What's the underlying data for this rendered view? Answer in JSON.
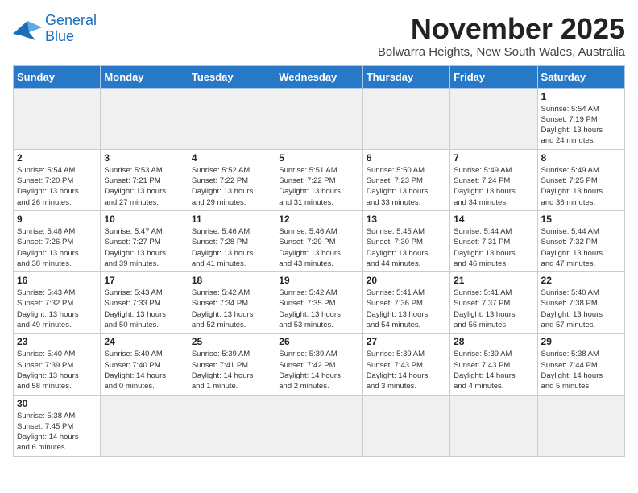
{
  "logo": {
    "line1": "General",
    "line2": "Blue"
  },
  "title": "November 2025",
  "location": "Bolwarra Heights, New South Wales, Australia",
  "weekdays": [
    "Sunday",
    "Monday",
    "Tuesday",
    "Wednesday",
    "Thursday",
    "Friday",
    "Saturday"
  ],
  "weeks": [
    [
      {
        "day": "",
        "info": ""
      },
      {
        "day": "",
        "info": ""
      },
      {
        "day": "",
        "info": ""
      },
      {
        "day": "",
        "info": ""
      },
      {
        "day": "",
        "info": ""
      },
      {
        "day": "",
        "info": ""
      },
      {
        "day": "1",
        "info": "Sunrise: 5:54 AM\nSunset: 7:19 PM\nDaylight: 13 hours\nand 24 minutes."
      }
    ],
    [
      {
        "day": "2",
        "info": "Sunrise: 5:54 AM\nSunset: 7:20 PM\nDaylight: 13 hours\nand 26 minutes."
      },
      {
        "day": "3",
        "info": "Sunrise: 5:53 AM\nSunset: 7:21 PM\nDaylight: 13 hours\nand 27 minutes."
      },
      {
        "day": "4",
        "info": "Sunrise: 5:52 AM\nSunset: 7:22 PM\nDaylight: 13 hours\nand 29 minutes."
      },
      {
        "day": "5",
        "info": "Sunrise: 5:51 AM\nSunset: 7:22 PM\nDaylight: 13 hours\nand 31 minutes."
      },
      {
        "day": "6",
        "info": "Sunrise: 5:50 AM\nSunset: 7:23 PM\nDaylight: 13 hours\nand 33 minutes."
      },
      {
        "day": "7",
        "info": "Sunrise: 5:49 AM\nSunset: 7:24 PM\nDaylight: 13 hours\nand 34 minutes."
      },
      {
        "day": "8",
        "info": "Sunrise: 5:49 AM\nSunset: 7:25 PM\nDaylight: 13 hours\nand 36 minutes."
      }
    ],
    [
      {
        "day": "9",
        "info": "Sunrise: 5:48 AM\nSunset: 7:26 PM\nDaylight: 13 hours\nand 38 minutes."
      },
      {
        "day": "10",
        "info": "Sunrise: 5:47 AM\nSunset: 7:27 PM\nDaylight: 13 hours\nand 39 minutes."
      },
      {
        "day": "11",
        "info": "Sunrise: 5:46 AM\nSunset: 7:28 PM\nDaylight: 13 hours\nand 41 minutes."
      },
      {
        "day": "12",
        "info": "Sunrise: 5:46 AM\nSunset: 7:29 PM\nDaylight: 13 hours\nand 43 minutes."
      },
      {
        "day": "13",
        "info": "Sunrise: 5:45 AM\nSunset: 7:30 PM\nDaylight: 13 hours\nand 44 minutes."
      },
      {
        "day": "14",
        "info": "Sunrise: 5:44 AM\nSunset: 7:31 PM\nDaylight: 13 hours\nand 46 minutes."
      },
      {
        "day": "15",
        "info": "Sunrise: 5:44 AM\nSunset: 7:32 PM\nDaylight: 13 hours\nand 47 minutes."
      }
    ],
    [
      {
        "day": "16",
        "info": "Sunrise: 5:43 AM\nSunset: 7:32 PM\nDaylight: 13 hours\nand 49 minutes."
      },
      {
        "day": "17",
        "info": "Sunrise: 5:43 AM\nSunset: 7:33 PM\nDaylight: 13 hours\nand 50 minutes."
      },
      {
        "day": "18",
        "info": "Sunrise: 5:42 AM\nSunset: 7:34 PM\nDaylight: 13 hours\nand 52 minutes."
      },
      {
        "day": "19",
        "info": "Sunrise: 5:42 AM\nSunset: 7:35 PM\nDaylight: 13 hours\nand 53 minutes."
      },
      {
        "day": "20",
        "info": "Sunrise: 5:41 AM\nSunset: 7:36 PM\nDaylight: 13 hours\nand 54 minutes."
      },
      {
        "day": "21",
        "info": "Sunrise: 5:41 AM\nSunset: 7:37 PM\nDaylight: 13 hours\nand 56 minutes."
      },
      {
        "day": "22",
        "info": "Sunrise: 5:40 AM\nSunset: 7:38 PM\nDaylight: 13 hours\nand 57 minutes."
      }
    ],
    [
      {
        "day": "23",
        "info": "Sunrise: 5:40 AM\nSunset: 7:39 PM\nDaylight: 13 hours\nand 58 minutes."
      },
      {
        "day": "24",
        "info": "Sunrise: 5:40 AM\nSunset: 7:40 PM\nDaylight: 14 hours\nand 0 minutes."
      },
      {
        "day": "25",
        "info": "Sunrise: 5:39 AM\nSunset: 7:41 PM\nDaylight: 14 hours\nand 1 minute."
      },
      {
        "day": "26",
        "info": "Sunrise: 5:39 AM\nSunset: 7:42 PM\nDaylight: 14 hours\nand 2 minutes."
      },
      {
        "day": "27",
        "info": "Sunrise: 5:39 AM\nSunset: 7:43 PM\nDaylight: 14 hours\nand 3 minutes."
      },
      {
        "day": "28",
        "info": "Sunrise: 5:39 AM\nSunset: 7:43 PM\nDaylight: 14 hours\nand 4 minutes."
      },
      {
        "day": "29",
        "info": "Sunrise: 5:38 AM\nSunset: 7:44 PM\nDaylight: 14 hours\nand 5 minutes."
      }
    ],
    [
      {
        "day": "30",
        "info": "Sunrise: 5:38 AM\nSunset: 7:45 PM\nDaylight: 14 hours\nand 6 minutes."
      },
      {
        "day": "",
        "info": ""
      },
      {
        "day": "",
        "info": ""
      },
      {
        "day": "",
        "info": ""
      },
      {
        "day": "",
        "info": ""
      },
      {
        "day": "",
        "info": ""
      },
      {
        "day": "",
        "info": ""
      }
    ]
  ]
}
